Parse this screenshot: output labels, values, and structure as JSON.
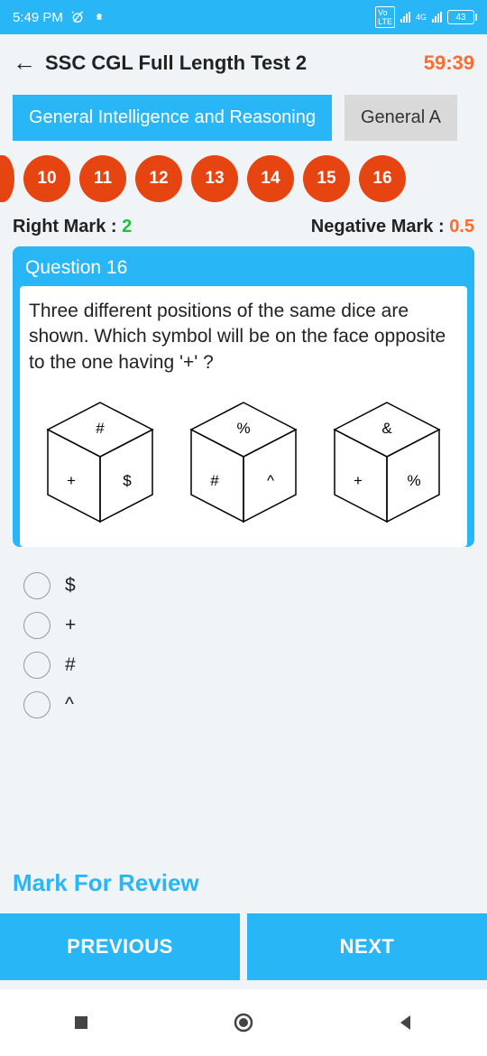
{
  "status": {
    "time": "5:49 PM",
    "battery": "43"
  },
  "header": {
    "title": "SSC CGL Full Length Test 2",
    "timer": "59:39"
  },
  "tabs": {
    "active": "General Intelligence and Reasoning",
    "inactive": "General A"
  },
  "qnums": [
    "10",
    "11",
    "12",
    "13",
    "14",
    "15",
    "16"
  ],
  "marks": {
    "right_label": "Right Mark : ",
    "right_value": "2",
    "neg_label": "Negative Mark : ",
    "neg_value": "0.5"
  },
  "question": {
    "label": "Question 16",
    "text": "Three different positions of the same dice are shown. Which symbol will be on the face opposite to the one having '+' ?",
    "dice": [
      {
        "top": "#",
        "left": "+",
        "right": "$"
      },
      {
        "top": "%",
        "left": "#",
        "right": "^"
      },
      {
        "top": "&",
        "left": "+",
        "right": "%"
      }
    ]
  },
  "options": [
    "$",
    "+",
    "#",
    "^"
  ],
  "mark_review": "Mark For Review",
  "buttons": {
    "prev": "PREVIOUS",
    "next": "NEXT"
  }
}
